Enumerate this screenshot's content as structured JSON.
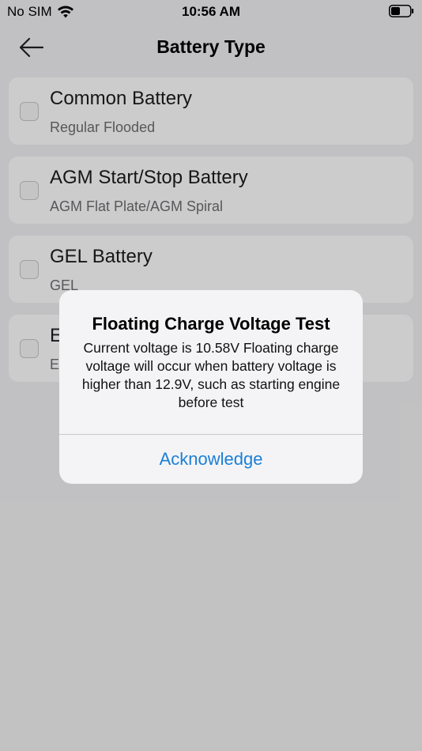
{
  "status_bar": {
    "carrier": "No SIM",
    "time": "10:56 AM",
    "wifi_icon": "wifi-icon",
    "battery_icon": "battery-icon"
  },
  "nav": {
    "title": "Battery Type",
    "back_icon": "arrow-left-icon"
  },
  "battery_types": [
    {
      "title": "Common Battery",
      "subtitle": "Regular Flooded"
    },
    {
      "title": "AGM Start/Stop Battery",
      "subtitle": "AGM Flat Plate/AGM Spiral"
    },
    {
      "title": "GEL Battery",
      "subtitle": "GEL"
    },
    {
      "title": "E",
      "subtitle": "E"
    }
  ],
  "alert": {
    "title": "Floating Charge Voltage Test",
    "message": "Current voltage is 10.58V  Floating charge voltage will occur when battery voltage is higher than 12.9V, such as starting engine before test",
    "button_label": "Acknowledge"
  },
  "colors": {
    "accent": "#1a7fd6",
    "background": "#f2f2f4",
    "card": "#ffffff"
  }
}
